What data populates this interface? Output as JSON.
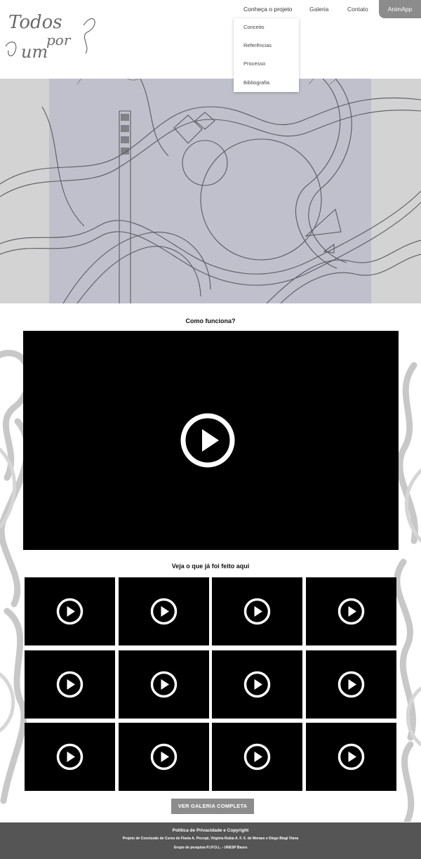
{
  "logo": {
    "line1": "Todos",
    "line2": "por",
    "line3": "um"
  },
  "nav": {
    "items": [
      "Conheça o projeto",
      "Galeria",
      "Contato"
    ],
    "app_label": "AnimApp"
  },
  "dropdown": {
    "items": [
      "Conceito",
      "Referências",
      "Processo",
      "Bibliografia"
    ]
  },
  "main": {
    "video_title": "Como funciona?",
    "gallery_title": "Veja o que já foi feito aqui",
    "gallery_button": "VER GALERIA COMPLETA",
    "thumbnail_count": 12
  },
  "footer": {
    "line1": "Política de Privacidade e Copyright",
    "line2": "Projeto de Conclusão de Curso de Flavia A. Piccopi, Virgínia Rubia A. F. X. de Moraes e Diego Biagi Viana",
    "line3": "Grupo de pesquisa P.I.P.O.L. - UNESP Bauru"
  },
  "colors": {
    "accent_gray": "#8c8c8c",
    "footer_bg": "#555555",
    "hero_bg": "#d3d3d3",
    "video_bg": "#000000"
  }
}
